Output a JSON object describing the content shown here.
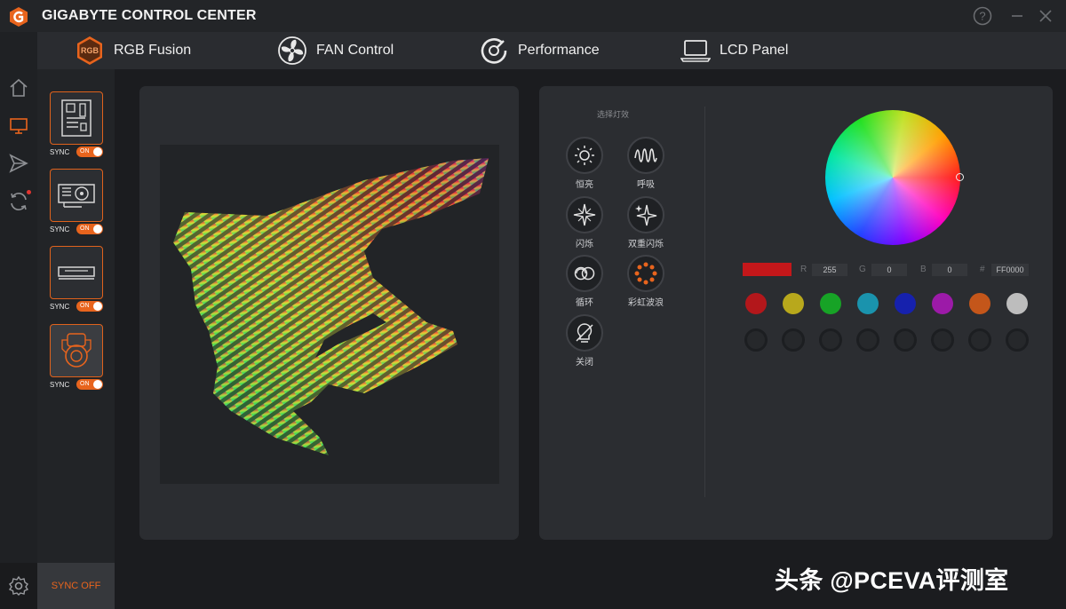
{
  "window": {
    "title": "GIGABYTE CONTROL CENTER"
  },
  "nav": {
    "items": [
      {
        "label": "RGB Fusion",
        "icon": "rgb-logo-icon"
      },
      {
        "label": "FAN Control",
        "icon": "fan-icon"
      },
      {
        "label": "Performance",
        "icon": "gauge-icon"
      },
      {
        "label": "LCD Panel",
        "icon": "laptop-icon"
      }
    ]
  },
  "devices": [
    {
      "icon": "motherboard-icon",
      "sync_label": "SYNC",
      "toggle": "ON"
    },
    {
      "icon": "graphics-card-icon",
      "sync_label": "SYNC",
      "toggle": "ON"
    },
    {
      "icon": "memory-icon",
      "sync_label": "SYNC",
      "toggle": "ON"
    },
    {
      "icon": "cooler-icon",
      "sync_label": "SYNC",
      "toggle": "ON"
    }
  ],
  "sync_off": "SYNC OFF",
  "effects": {
    "title": "选择灯效",
    "items": [
      {
        "label": "恒亮",
        "icon": "sun-icon"
      },
      {
        "label": "呼吸",
        "icon": "wave-icon"
      },
      {
        "label": "闪烁",
        "icon": "flash-star-icon"
      },
      {
        "label": "双重闪烁",
        "icon": "double-flash-icon"
      },
      {
        "label": "循环",
        "icon": "cycle-icon"
      },
      {
        "label": "彩虹波浪",
        "icon": "rainbow-wave-icon"
      },
      {
        "label": "关闭",
        "icon": "bulb-off-icon"
      }
    ]
  },
  "color": {
    "current_hex_color": "#c4171a",
    "r_label": "R",
    "r_value": "255",
    "g_label": "G",
    "g_value": "0",
    "b_label": "B",
    "b_value": "0",
    "hex_label": "#",
    "hex_value": "FF0000",
    "presets": [
      "#b3171b",
      "#b8a81c",
      "#17a326",
      "#1a93ad",
      "#1621ad",
      "#9c1aa8",
      "#c4561a",
      "#bdbdbd"
    ]
  },
  "watermark": "头条 @PCEVA评测室"
}
